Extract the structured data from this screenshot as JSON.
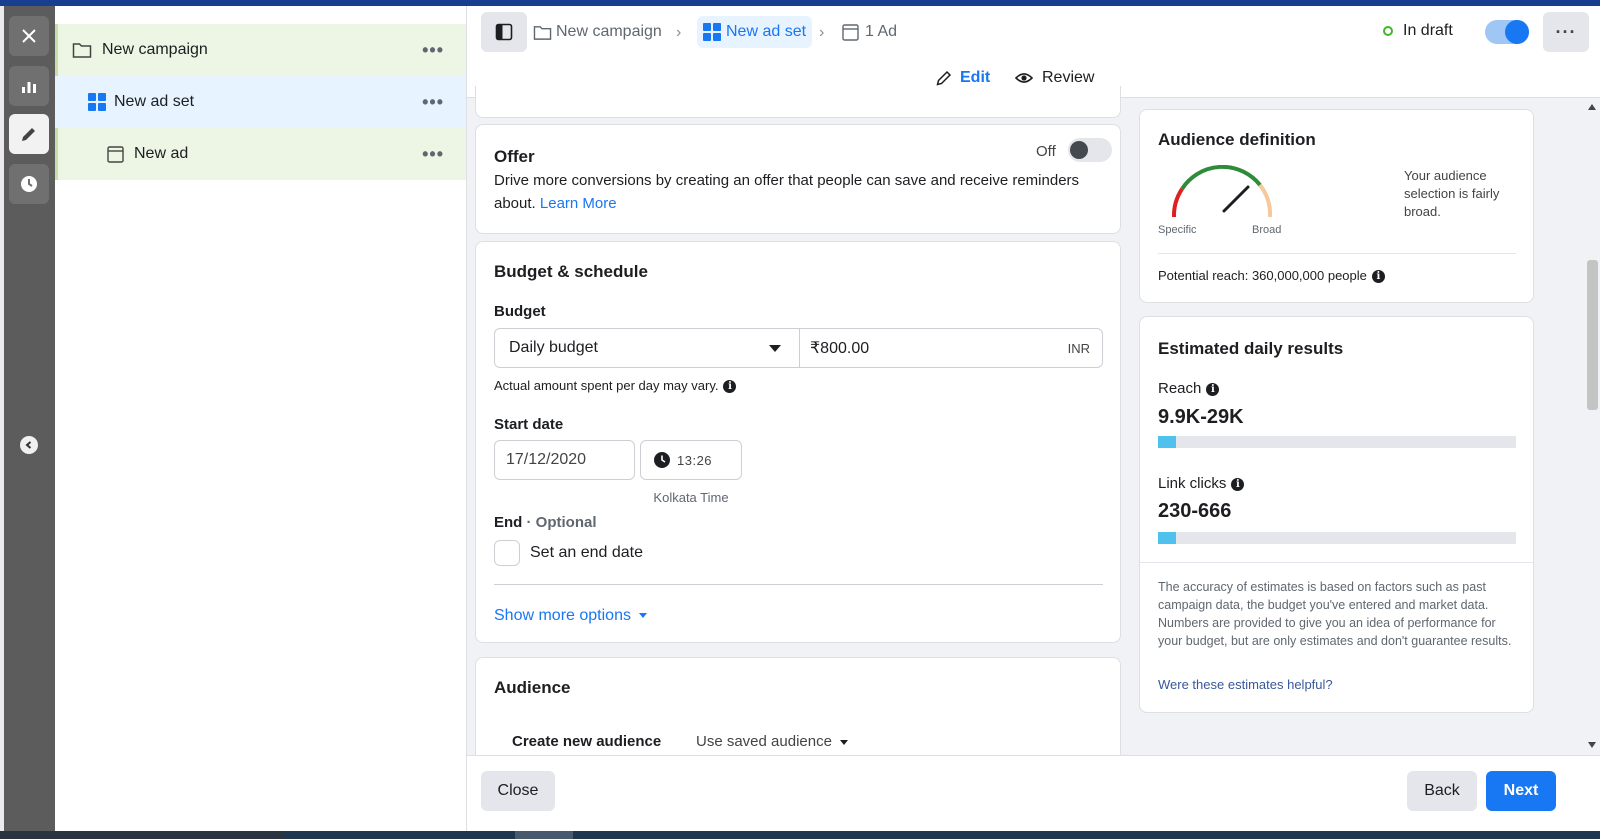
{
  "tree": {
    "items": [
      {
        "label": "New campaign",
        "icon": "folder-icon"
      },
      {
        "label": "New ad set",
        "icon": "grid-icon"
      },
      {
        "label": "New ad",
        "icon": "ad-icon"
      }
    ],
    "more": "•••"
  },
  "header": {
    "breadcrumbs": [
      "New campaign",
      "New ad set",
      "1 Ad"
    ],
    "status": "In draft",
    "tabs": {
      "edit": "Edit",
      "review": "Review"
    }
  },
  "offer": {
    "title": "Offer",
    "toggle_label": "Off",
    "description": "Drive more conversions by creating an offer that people can save and receive reminders about.",
    "learn_more": "Learn More"
  },
  "budget": {
    "section_title": "Budget & schedule",
    "budget_label": "Budget",
    "budget_type": "Daily budget",
    "amount": "₹800.00",
    "currency": "INR",
    "note": "Actual amount spent per day may vary.",
    "start_label": "Start date",
    "start_date": "17/12/2020",
    "start_time": "13:26",
    "timezone": "Kolkata Time",
    "end_label": "End",
    "end_optional": "· Optional",
    "end_checkbox": "Set an end date",
    "more_options": "Show more options"
  },
  "audience": {
    "title": "Audience",
    "create_new": "Create new audience",
    "use_saved": "Use saved audience"
  },
  "audience_definition": {
    "title": "Audience definition",
    "gauge_specific": "Specific",
    "gauge_broad": "Broad",
    "summary": "Your audience selection is fairly broad.",
    "potential_reach": "Potential reach: 360,000,000 people"
  },
  "estimates": {
    "title": "Estimated daily results",
    "reach_label": "Reach",
    "reach_value": "9.9K-29K",
    "reach_fill": 0.05,
    "clicks_label": "Link clicks",
    "clicks_value": "230-666",
    "clicks_fill": 0.05,
    "disclaimer": "The accuracy of estimates is based on factors such as past campaign data, the budget you've entered and market data. Numbers are provided to give you an idea of performance for your budget, but are only estimates and don't guarantee results.",
    "helpful_link": "Were these estimates helpful?"
  },
  "footer": {
    "close": "Close",
    "back": "Back",
    "next": "Next"
  },
  "colors": {
    "accent": "#1877f2",
    "draft_dot": "#42b72a",
    "bar": "#50c0ec"
  }
}
